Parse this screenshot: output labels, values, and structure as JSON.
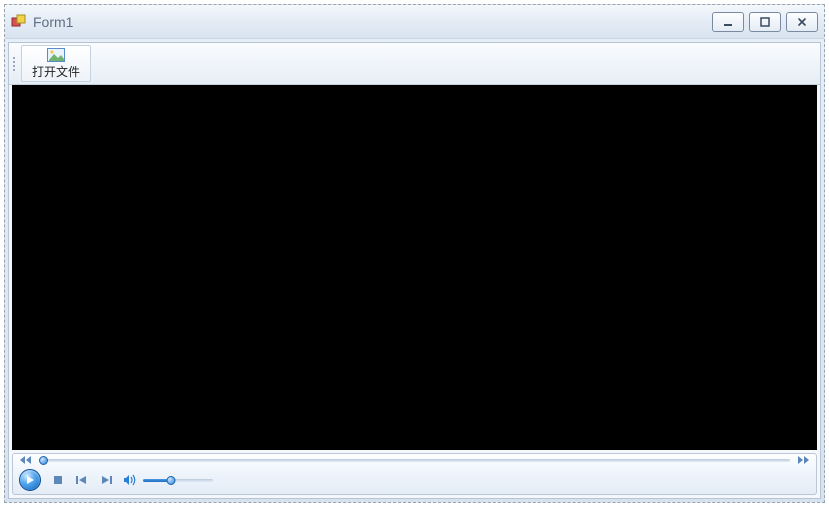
{
  "window": {
    "title": "Form1"
  },
  "toolbar": {
    "open_file_label": "打开文件"
  },
  "player": {
    "seek_position_percent": 0,
    "volume_percent": 40
  },
  "colors": {
    "accent": "#2a7fd8",
    "video_bg": "#000000"
  }
}
